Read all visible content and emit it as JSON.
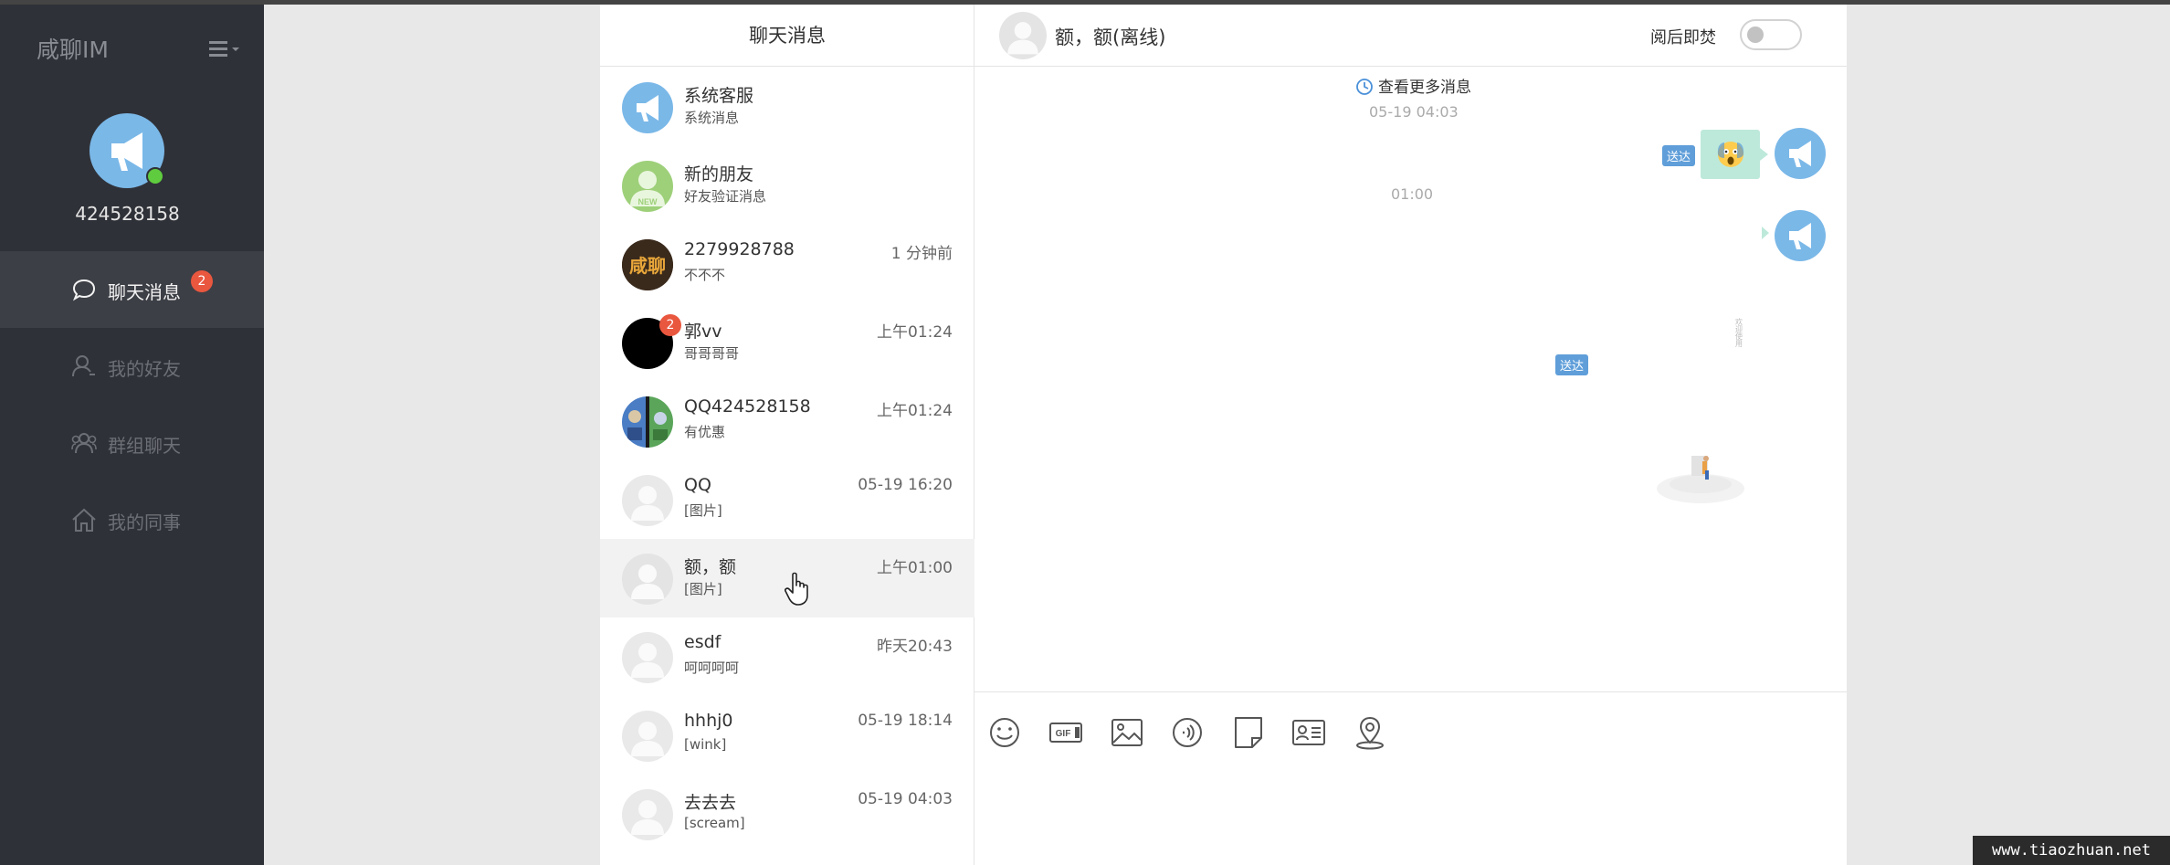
{
  "app": {
    "brand": "咸聊IM",
    "user_id": "424528158",
    "status_color": "#5fcc3f",
    "accent_color": "#7ab8e8"
  },
  "nav": {
    "items": [
      {
        "label": "聊天消息",
        "icon": "chat-bubble-icon",
        "badge": "2",
        "active": true
      },
      {
        "label": "我的好友",
        "icon": "user-icon",
        "active": false
      },
      {
        "label": "群组聊天",
        "icon": "users-group-icon",
        "active": false
      },
      {
        "label": "我的同事",
        "icon": "home-icon",
        "active": false
      }
    ]
  },
  "conversations": {
    "title": "聊天消息",
    "items": [
      {
        "name": "系统客服",
        "preview": "系统消息",
        "time": "",
        "avatar": "megaphone"
      },
      {
        "name": "新的朋友",
        "preview": "好友验证消息",
        "time": "",
        "avatar": "new-user",
        "avatar_text": "NEW"
      },
      {
        "name": "2279928788",
        "preview": "不不不",
        "time": "1 分钟前",
        "avatar": "brand-logo",
        "avatar_text": "咸聊"
      },
      {
        "name": "郭vv",
        "preview": "哥哥哥哥",
        "time": "上午01:24",
        "avatar": "black",
        "badge": "2"
      },
      {
        "name": "QQ424528158",
        "preview": "有优惠",
        "time": "上午01:24",
        "avatar": "photo"
      },
      {
        "name": "QQ",
        "preview": "[图片]",
        "time": "05-19 16:20",
        "avatar": "default"
      },
      {
        "name": "额，额",
        "preview": "[图片]",
        "time": "上午01:00",
        "avatar": "default",
        "selected": true
      },
      {
        "name": "esdf",
        "preview": "呵呵呵呵",
        "time": "昨天20:43",
        "avatar": "default"
      },
      {
        "name": "hhhj0",
        "preview": "[wink]",
        "time": "05-19 18:14",
        "avatar": "default"
      },
      {
        "name": "去去去",
        "preview": "[scream]",
        "time": "05-19 04:03",
        "avatar": "default"
      }
    ]
  },
  "chat": {
    "contact_name": "额，额(离线)",
    "burn_after_read_label": "阅后即焚",
    "burn_after_read_on": false,
    "load_more_label": "查看更多消息",
    "timestamps": [
      "05-19 04:03",
      "01:00"
    ],
    "delivered_label": "送达",
    "image_caption": "欢迎使用",
    "toolbar": [
      "emoji-icon",
      "gif-icon",
      "image-icon",
      "voice-icon",
      "file-icon",
      "contact-card-icon",
      "location-icon"
    ],
    "gif_text": "GIF"
  },
  "watermark": "www.tiaozhuan.net"
}
